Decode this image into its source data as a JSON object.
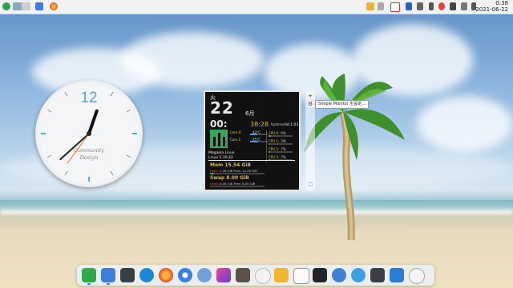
{
  "top_panel": {
    "clock_time": "0:38",
    "clock_date": "2021-06-22",
    "left_icons": [
      "app-launcher-icon",
      "workspace-switcher-icon",
      "file-manager-icon",
      "firefox-icon"
    ],
    "tray_icons": [
      "chat-icon",
      "notifications-icon",
      "window-icon",
      "lock-icon",
      "network-icon",
      "bluetooth-icon",
      "record-icon",
      "volume-icon",
      "display-icon",
      "battery-icon",
      "power-icon"
    ]
  },
  "analog_clock": {
    "twelve": "12",
    "brand_line1": "Community",
    "brand_line2": "Design",
    "hour": 12,
    "minute": 38,
    "second": 36
  },
  "monitor": {
    "day": "火",
    "date": "22",
    "month": "6月",
    "time": "00:",
    "time_sec": "38:28",
    "uptime_label": "Uptime:",
    "uptime": "0d 1:03",
    "cores": [
      {
        "label": "Core 0:",
        "value": "43°C",
        "fill": 0.43
      },
      {
        "label": "Core 1:",
        "value": "45°C",
        "fill": 0.45
      }
    ],
    "cpus": [
      {
        "label": "CPU 0:",
        "value": "9%",
        "fill": 0.09
      },
      {
        "label": "CPU 1:",
        "value": "3%",
        "fill": 0.03
      },
      {
        "label": "CPU 2:",
        "value": "7%",
        "fill": 0.07
      },
      {
        "label": "CPU 3:",
        "value": "7%",
        "fill": 0.07
      }
    ],
    "os_name": "Magaeia Linux",
    "kernel": "Linux 5.10.42",
    "mem_title": "Mem 15.54 GiB",
    "mem_used": "1.28 GiB",
    "mem_free": "14.26 GiB",
    "mem_fill": 0.08,
    "swap_title": "Swap 8.00 GiB",
    "swap_used": "0.00 GiB",
    "swap_free": "8.00 GiB",
    "swap_fill": 0.0,
    "used_label": "Used:",
    "free_label": "Free:"
  },
  "widget_controls": {
    "add_label": "+",
    "settings_label": "⚙",
    "close_label": "○",
    "tooltip": "Simple Monitor を設定..."
  },
  "dock": {
    "icons": [
      "system-monitor-icon",
      "files-icon",
      "terminal-icon",
      "tools-icon",
      "firefox-icon",
      "chromium-icon",
      "network-icon",
      "screenshot-icon",
      "gimp-icon",
      "compass-icon",
      "video-player-icon",
      "document-icon",
      "text-editor-icon",
      "media-icon",
      "toggle-icon",
      "cloud-icon",
      "store-icon",
      "time-icon"
    ]
  }
}
